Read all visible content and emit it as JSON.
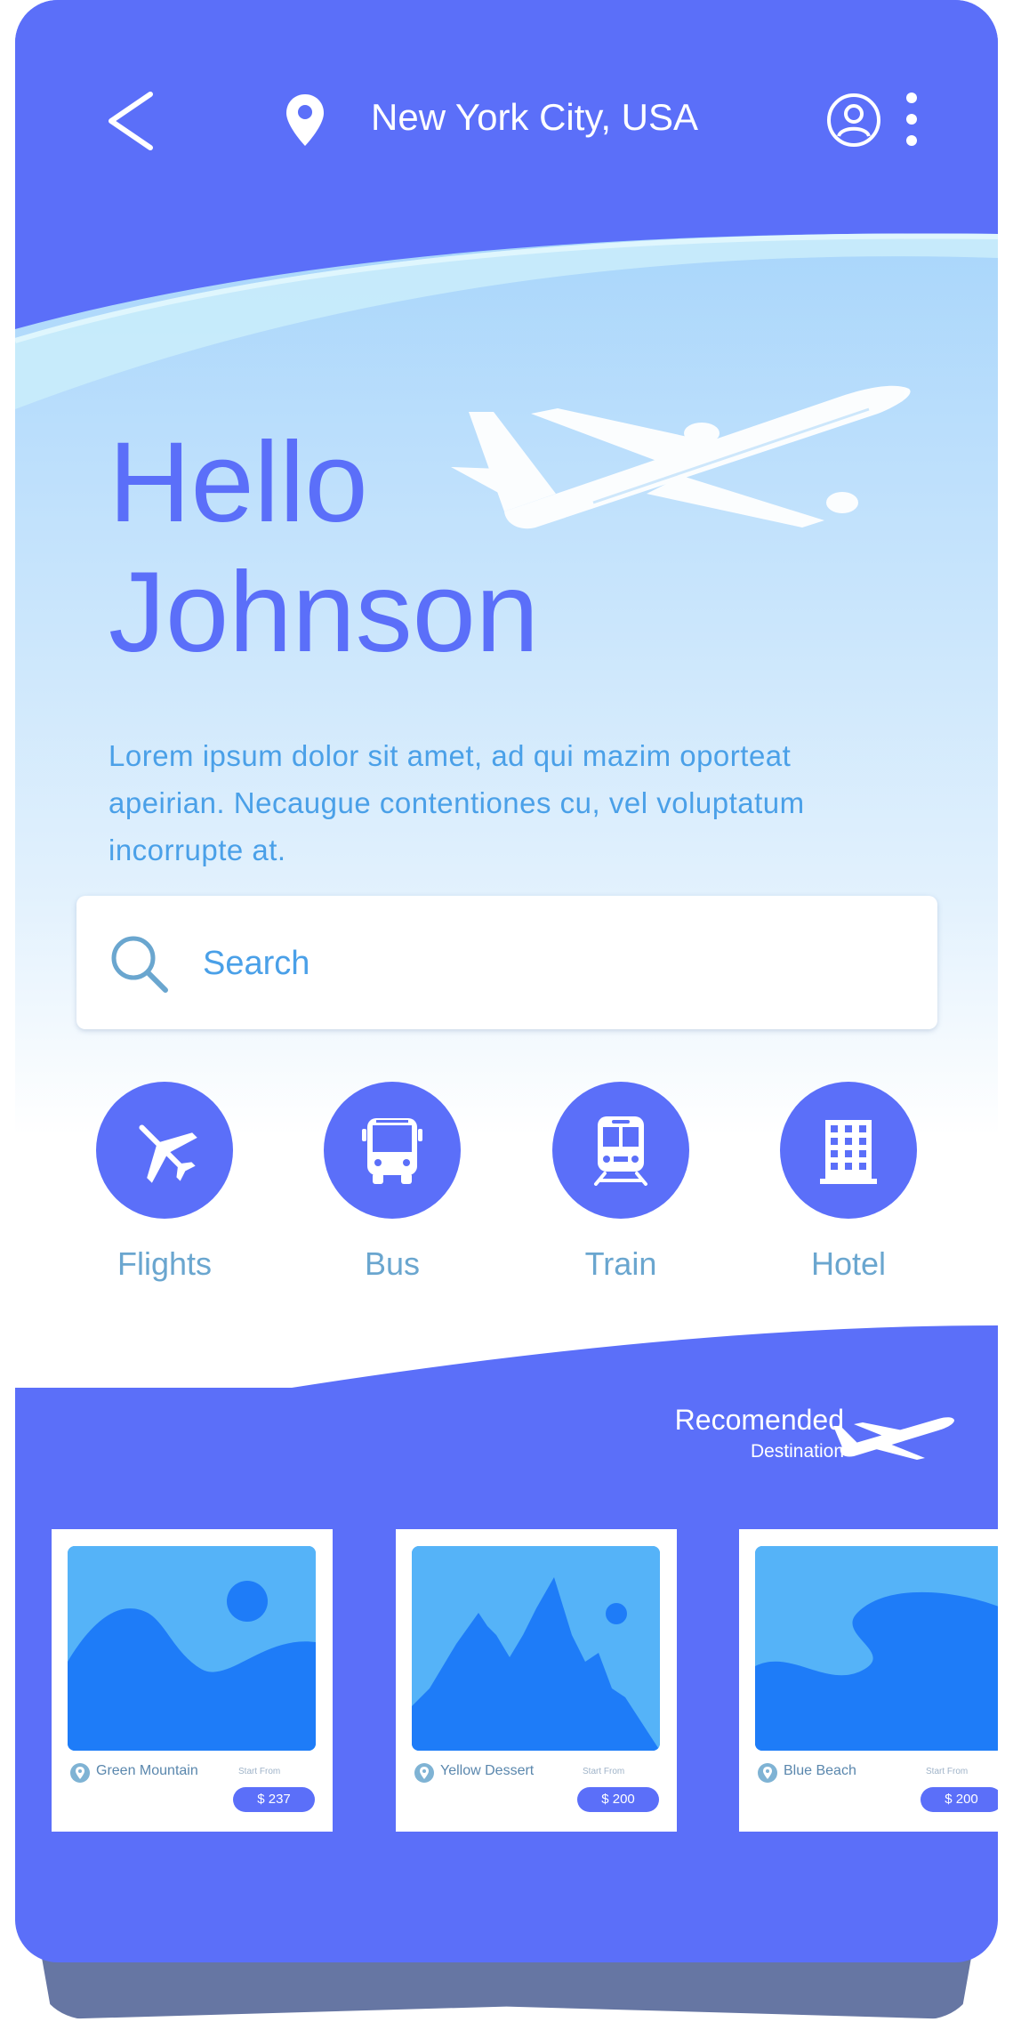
{
  "header": {
    "location": "New York City, USA",
    "back_icon": "chevron-left-icon",
    "location_icon": "map-pin-icon",
    "user_icon": "user-circle-icon",
    "more_icon": "more-vertical-icon"
  },
  "hero": {
    "greeting_line1": "Hello",
    "greeting_line2": "Johnson",
    "description": "Lorem ipsum dolor sit amet, ad qui mazim oporteat apeirian. Necaugue contentiones cu, vel voluptatum incorrupte at."
  },
  "search": {
    "placeholder": "Search"
  },
  "categories": [
    {
      "label": "Flights",
      "icon": "airplane-icon"
    },
    {
      "label": "Bus",
      "icon": "bus-icon"
    },
    {
      "label": "Train",
      "icon": "train-icon"
    },
    {
      "label": "Hotel",
      "icon": "building-icon"
    }
  ],
  "recommended": {
    "title": "Recomended",
    "subtitle": "Destination"
  },
  "destinations": [
    {
      "name": "Green Mountain",
      "from_label": "Start From",
      "price": "$ 237"
    },
    {
      "name": "Yellow Dessert",
      "from_label": "Start From",
      "price": "$ 200"
    },
    {
      "name": "Blue Beach",
      "from_label": "Start From",
      "price": "$ 200"
    }
  ],
  "colors": {
    "primary": "#5b6ff9",
    "sky_top": "#b3dcfb",
    "text_accent": "#4aa0e8",
    "label": "#6aa6cf"
  }
}
